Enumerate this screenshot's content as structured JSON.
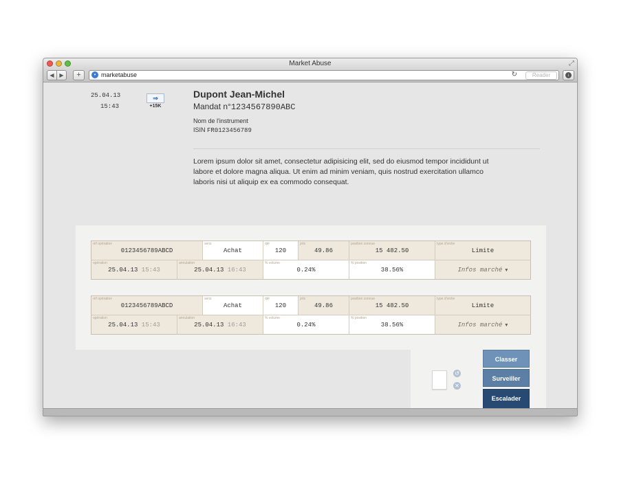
{
  "window": {
    "title": "Market Abuse",
    "url": "marketabuse",
    "reader_label": "Reader",
    "nav_back": "◀",
    "nav_forward": "▶",
    "new_tab": "+"
  },
  "header": {
    "date": "25.04.13",
    "time": "15:43",
    "flag_label": "+15K",
    "name": "Dupont Jean-Michel",
    "mandat_prefix": "Mandat n°",
    "mandat_number": "1234567890ABC",
    "instrument": "Nom de l'instrument",
    "isin_prefix": "ISIN",
    "isin_code": "FR0123456789",
    "description": "Lorem ipsum dolor sit amet, consectetur adipisicing elit, sed do eiusmod tempor incididunt ut labore et dolore magna aliqua. Ut enim ad minim veniam, quis nostrud exercitation ullamco laboris nisi ut aliquip ex ea commodo consequat."
  },
  "labels": {
    "ref": "réf opération",
    "sens": "sens",
    "qte": "qté",
    "prix": "prix",
    "position": "position connue",
    "type_ordre": "type d'ordre",
    "operation": "opération",
    "annulation": "annulation",
    "volume": "% volume",
    "pct_position": "% position"
  },
  "operations": [
    {
      "ref": "0123456789ABCD",
      "sens": "Achat",
      "qte": "120",
      "prix": "49.86",
      "position": "15 482.50",
      "type_ordre": "Limite",
      "op_date": "25.04.13",
      "op_time": "15:43",
      "ann_date": "25.04.13",
      "ann_time": "16:43",
      "volume": "0.24%",
      "pct_position": "38.56%",
      "infos": "Infos marché"
    },
    {
      "ref": "0123456789ABCD",
      "sens": "Achat",
      "qte": "120",
      "prix": "49.86",
      "position": "15 482.50",
      "type_ordre": "Limite",
      "op_date": "25.04.13",
      "op_time": "15:43",
      "ann_date": "25.04.13",
      "ann_time": "16:43",
      "volume": "0.24%",
      "pct_position": "38.56%",
      "infos": "Infos marché"
    }
  ],
  "actions": {
    "classer": "Classer",
    "surveiller": "Surveiller",
    "escalader": "Escalader"
  },
  "colors": {
    "beige_cell": "#efe8dd",
    "btn_classer": "#6f93b8",
    "btn_surveiller": "#5c7fa6",
    "btn_escalader": "#274a72"
  },
  "icons": {
    "flag": "arrow-badge-icon",
    "document": "document-icon",
    "undo": "undo-icon",
    "remove": "remove-icon"
  }
}
